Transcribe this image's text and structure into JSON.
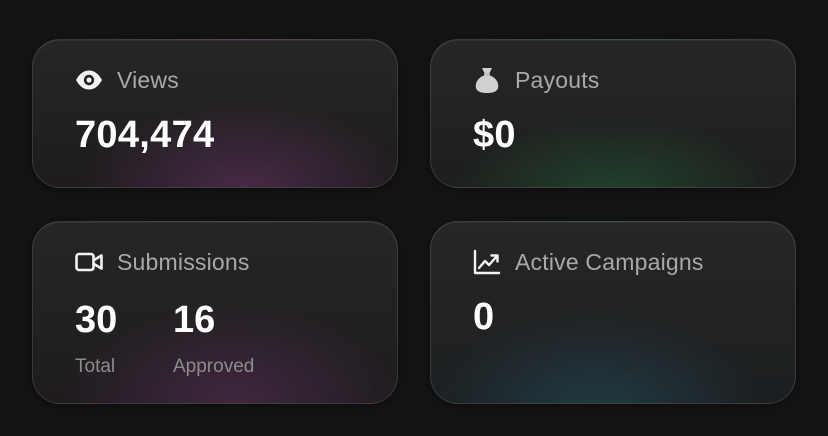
{
  "cards": {
    "views": {
      "title": "Views",
      "value": "704,474",
      "icon": "eye-icon"
    },
    "payouts": {
      "title": "Payouts",
      "value": "$0",
      "icon": "money-bag-icon"
    },
    "submissions": {
      "title": "Submissions",
      "icon": "video-camera-icon",
      "total_value": "30",
      "total_label": "Total",
      "approved_value": "16",
      "approved_label": "Approved"
    },
    "active_campaigns": {
      "title": "Active Campaigns",
      "value": "0",
      "icon": "trending-up-chart-icon"
    }
  },
  "colors": {
    "background": "#141414",
    "title_text": "#a9a9a9",
    "value_text": "#ffffff",
    "views_glow": "#783c78",
    "payouts_glow": "#287846",
    "submissions_glow": "#6e376e",
    "campaigns_glow": "#286478"
  }
}
